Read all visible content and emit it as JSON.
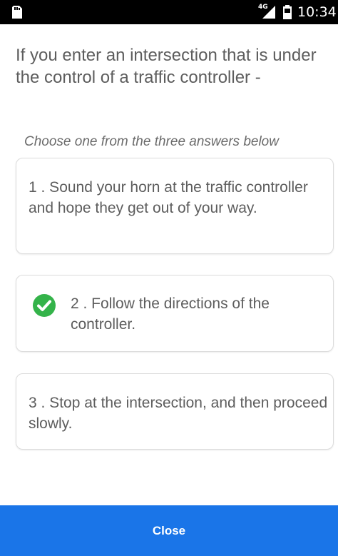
{
  "status_bar": {
    "network_type": "4G",
    "time": "10:34",
    "icons": [
      "sim-card-icon",
      "signal-icon",
      "battery-icon"
    ]
  },
  "quiz": {
    "question": "If you enter an intersection that is under the control of a traffic controller -",
    "instruction": "Choose one from the three answers below",
    "answers": [
      {
        "label": "1 . Sound your horn at the traffic controller and hope they get out of your way.",
        "correct": false
      },
      {
        "label": "2 . Follow the directions of the controller.",
        "correct": true
      },
      {
        "label": "3 . Stop at the intersection, and then proceed slowly.",
        "correct": false
      }
    ]
  },
  "footer": {
    "close_label": "Close"
  },
  "colors": {
    "status_bar_bg": "#000000",
    "text": "#5d5d5d",
    "correct_green": "#34b34a",
    "close_bar_bg": "#1a75e8",
    "close_text": "#ffffff",
    "card_border": "#dcdcdc"
  }
}
